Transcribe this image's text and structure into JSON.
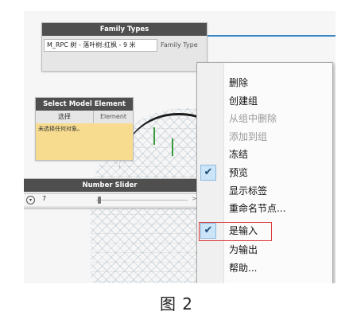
{
  "family_types_node": {
    "title": "Family Types",
    "dropdown_value": "M_RPC 树 - 落叶树:红枫 - 9 米",
    "output_port": "Family Type"
  },
  "select_model_node": {
    "title": "Select Model Element",
    "select_button": "选择",
    "output_port": "Element",
    "warning": "未选择任何对象。"
  },
  "number_slider_node": {
    "title": "Number Slider",
    "expander_icon": "chevron-down-icon",
    "value": "7",
    "arrow_label": ">"
  },
  "context_menu": {
    "items": [
      {
        "label": "删除",
        "enabled": true,
        "checked": false
      },
      {
        "label": "创建组",
        "enabled": true,
        "checked": false
      },
      {
        "label": "从组中删除",
        "enabled": false,
        "checked": false
      },
      {
        "label": "添加到组",
        "enabled": false,
        "checked": false
      },
      {
        "label": "冻结",
        "enabled": true,
        "checked": false
      },
      {
        "label": "预览",
        "enabled": true,
        "checked": true
      },
      {
        "label": "显示标签",
        "enabled": true,
        "checked": false
      },
      {
        "label": "重命名节点...",
        "enabled": true,
        "checked": false
      },
      {
        "label": "是输入",
        "enabled": true,
        "checked": true,
        "highlighted": true
      },
      {
        "label": "为输出",
        "enabled": true,
        "checked": false
      },
      {
        "label": "帮助...",
        "enabled": true,
        "checked": false
      }
    ],
    "check_glyph": "✔"
  },
  "caption": "图 2",
  "colors": {
    "node_header": "#4f4f4f",
    "wire": "#3b87c4",
    "warning_bg": "#f7dc90",
    "highlight_border": "#d93b3b",
    "check_bg": "#cce4f7"
  }
}
